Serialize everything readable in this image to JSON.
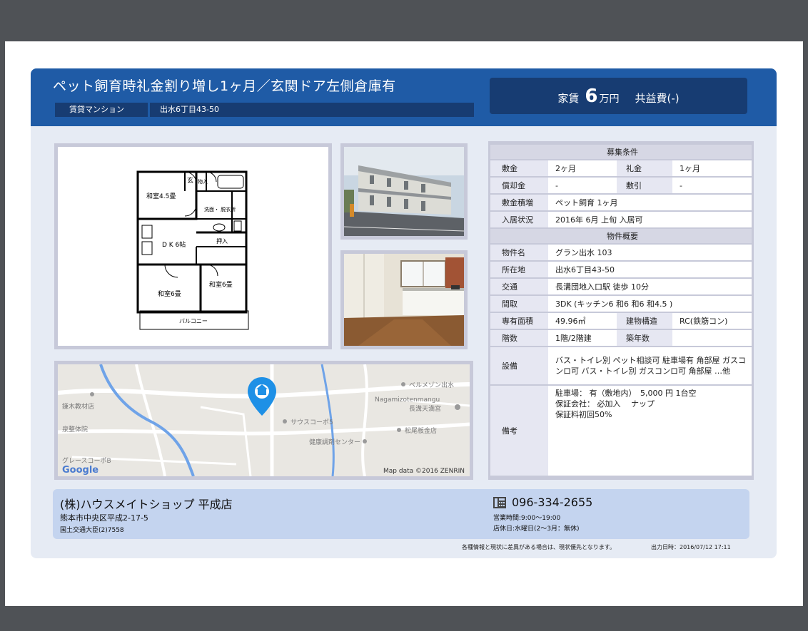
{
  "header": {
    "headline": "ペット飼育時礼金割り増し1ヶ月／玄関ドア左側倉庫有",
    "type_tag": "賃貸マンション",
    "address_tag": "出水6丁目43-50",
    "rent_label": "家賃",
    "rent_value": "6",
    "rent_unit": "万円",
    "common_fee": "共益費(-)"
  },
  "floorplan": {
    "room_a": "和室4.5畳",
    "entrance": "玄",
    "storage": "物入",
    "washroom": "洗面・\n脱衣所",
    "dk": "D K 6帖",
    "closet": "押入",
    "room_b": "和室6畳",
    "room_c": "和室6畳",
    "balcony": "バルコニー"
  },
  "map": {
    "labels": [
      "ベルメゾン出水",
      "Nagamizotenmangu",
      "長溝天満宮",
      "サウスコーポ5",
      "松尾板金店",
      "健康調剤センター",
      "鎌木教材店",
      "泉整体院",
      "グレースコーポB"
    ],
    "google_logo": "Google",
    "attribution": "Map data ©2016 ZENRIN"
  },
  "conditions": {
    "section_title": "募集条件",
    "rows": {
      "deposit_k": "敷金",
      "deposit_v": "2ヶ月",
      "key_k": "礼金",
      "key_v": "1ヶ月",
      "amort_k": "償却金",
      "amort_v": "-",
      "deduct_k": "敷引",
      "deduct_v": "-",
      "extra_k": "敷金積増",
      "extra_v": "ペット飼育 1ヶ月",
      "movein_k": "入居状況",
      "movein_v": "2016年 6月 上旬 入居可"
    }
  },
  "overview": {
    "section_title": "物件概要",
    "rows": {
      "name_k": "物件名",
      "name_v": "グラン出水 103",
      "loc_k": "所在地",
      "loc_v": "出水6丁目43-50",
      "access_k": "交通",
      "access_v": "長溝団地入口駅 徒歩 10分",
      "layout_k": "間取",
      "layout_v": "3DK (キッチン6 和6 和6 和4.5 )",
      "area_k": "専有面積",
      "area_v": "49.96㎡",
      "struct_k": "建物構造",
      "struct_v": "RC(鉄筋コン)",
      "floor_k": "階数",
      "floor_v": "1階/2階建",
      "age_k": "築年数",
      "age_v": "",
      "equip_k": "設備",
      "equip_v": "バス・トイレ別 ペット相談可 駐車場有 角部屋 ガスコンロ可 バス・トイレ別 ガスコンロ可 角部屋 …他",
      "notes_k": "備考",
      "notes_v1": "駐車場： 有（敷地内）　5,000 円 1台空",
      "notes_v2": "保証会社： 必加入　 ナップ",
      "notes_v3": "保証料初回50%"
    }
  },
  "shop": {
    "name": "(株)ハウスメイトショップ 平成店",
    "address": "熊本市中央区平成2-17-5",
    "license": "国土交通大臣(2)7558",
    "tel": "096-334-2655",
    "hours": "営業時間:9:00～19:00",
    "holiday": "店休日:水曜日(2～3月：無休)"
  },
  "footer": {
    "note": "各種情報と現状に差異がある場合は、現状優先となります。",
    "printed": "出力日時：2016/07/12 17:11"
  },
  "colors": {
    "header_blue": "#1f5ba6",
    "navy": "#173c72",
    "card_bg": "#e6ebf4",
    "shop_bg": "#c4d4ef",
    "pin_blue": "#1e90e6"
  }
}
